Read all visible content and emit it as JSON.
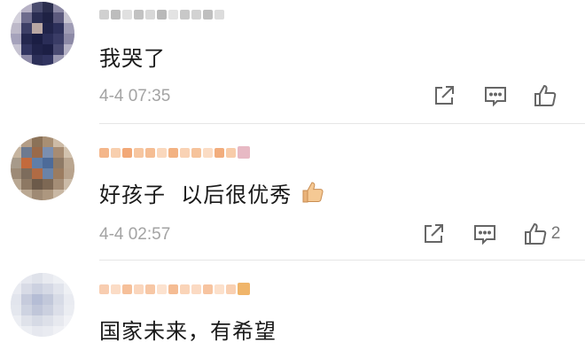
{
  "comments": [
    {
      "text": "我哭了",
      "timestamp": "4-4 07:35",
      "like_count": ""
    },
    {
      "text": "好孩子  以后很优秀",
      "emoji": "thumbs-up-emoji",
      "timestamp": "4-4 02:57",
      "like_count": "2"
    },
    {
      "text": "国家未来，有希望",
      "timestamp": "",
      "like_count": ""
    }
  ],
  "icons": {
    "share": "share-icon",
    "comment": "comment-icon",
    "like": "like-icon"
  },
  "colors": {
    "text": "#1a1a1a",
    "meta": "#a3a3a3",
    "icon": "#666666",
    "username_orange": "#f3a35f"
  }
}
